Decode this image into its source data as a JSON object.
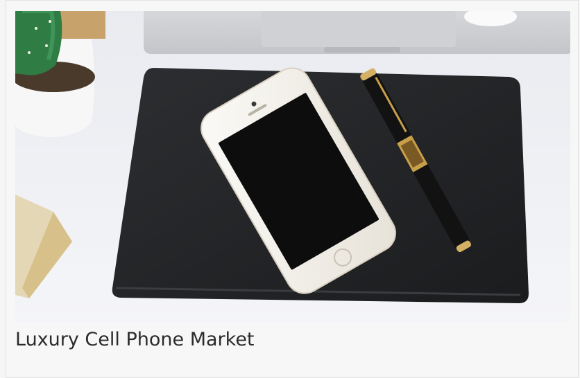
{
  "card": {
    "title": "Luxury Cell Phone Market",
    "image_alt": "Smartphone and pen on a black notebook on a white desk"
  },
  "colors": {
    "desk": "#eef0f4",
    "notebook": "#222426",
    "phone_body": "#f3f0ea",
    "phone_screen": "#0d0d0d",
    "pen_gold": "#c9a04a",
    "caption_text": "#2b2b2b"
  }
}
